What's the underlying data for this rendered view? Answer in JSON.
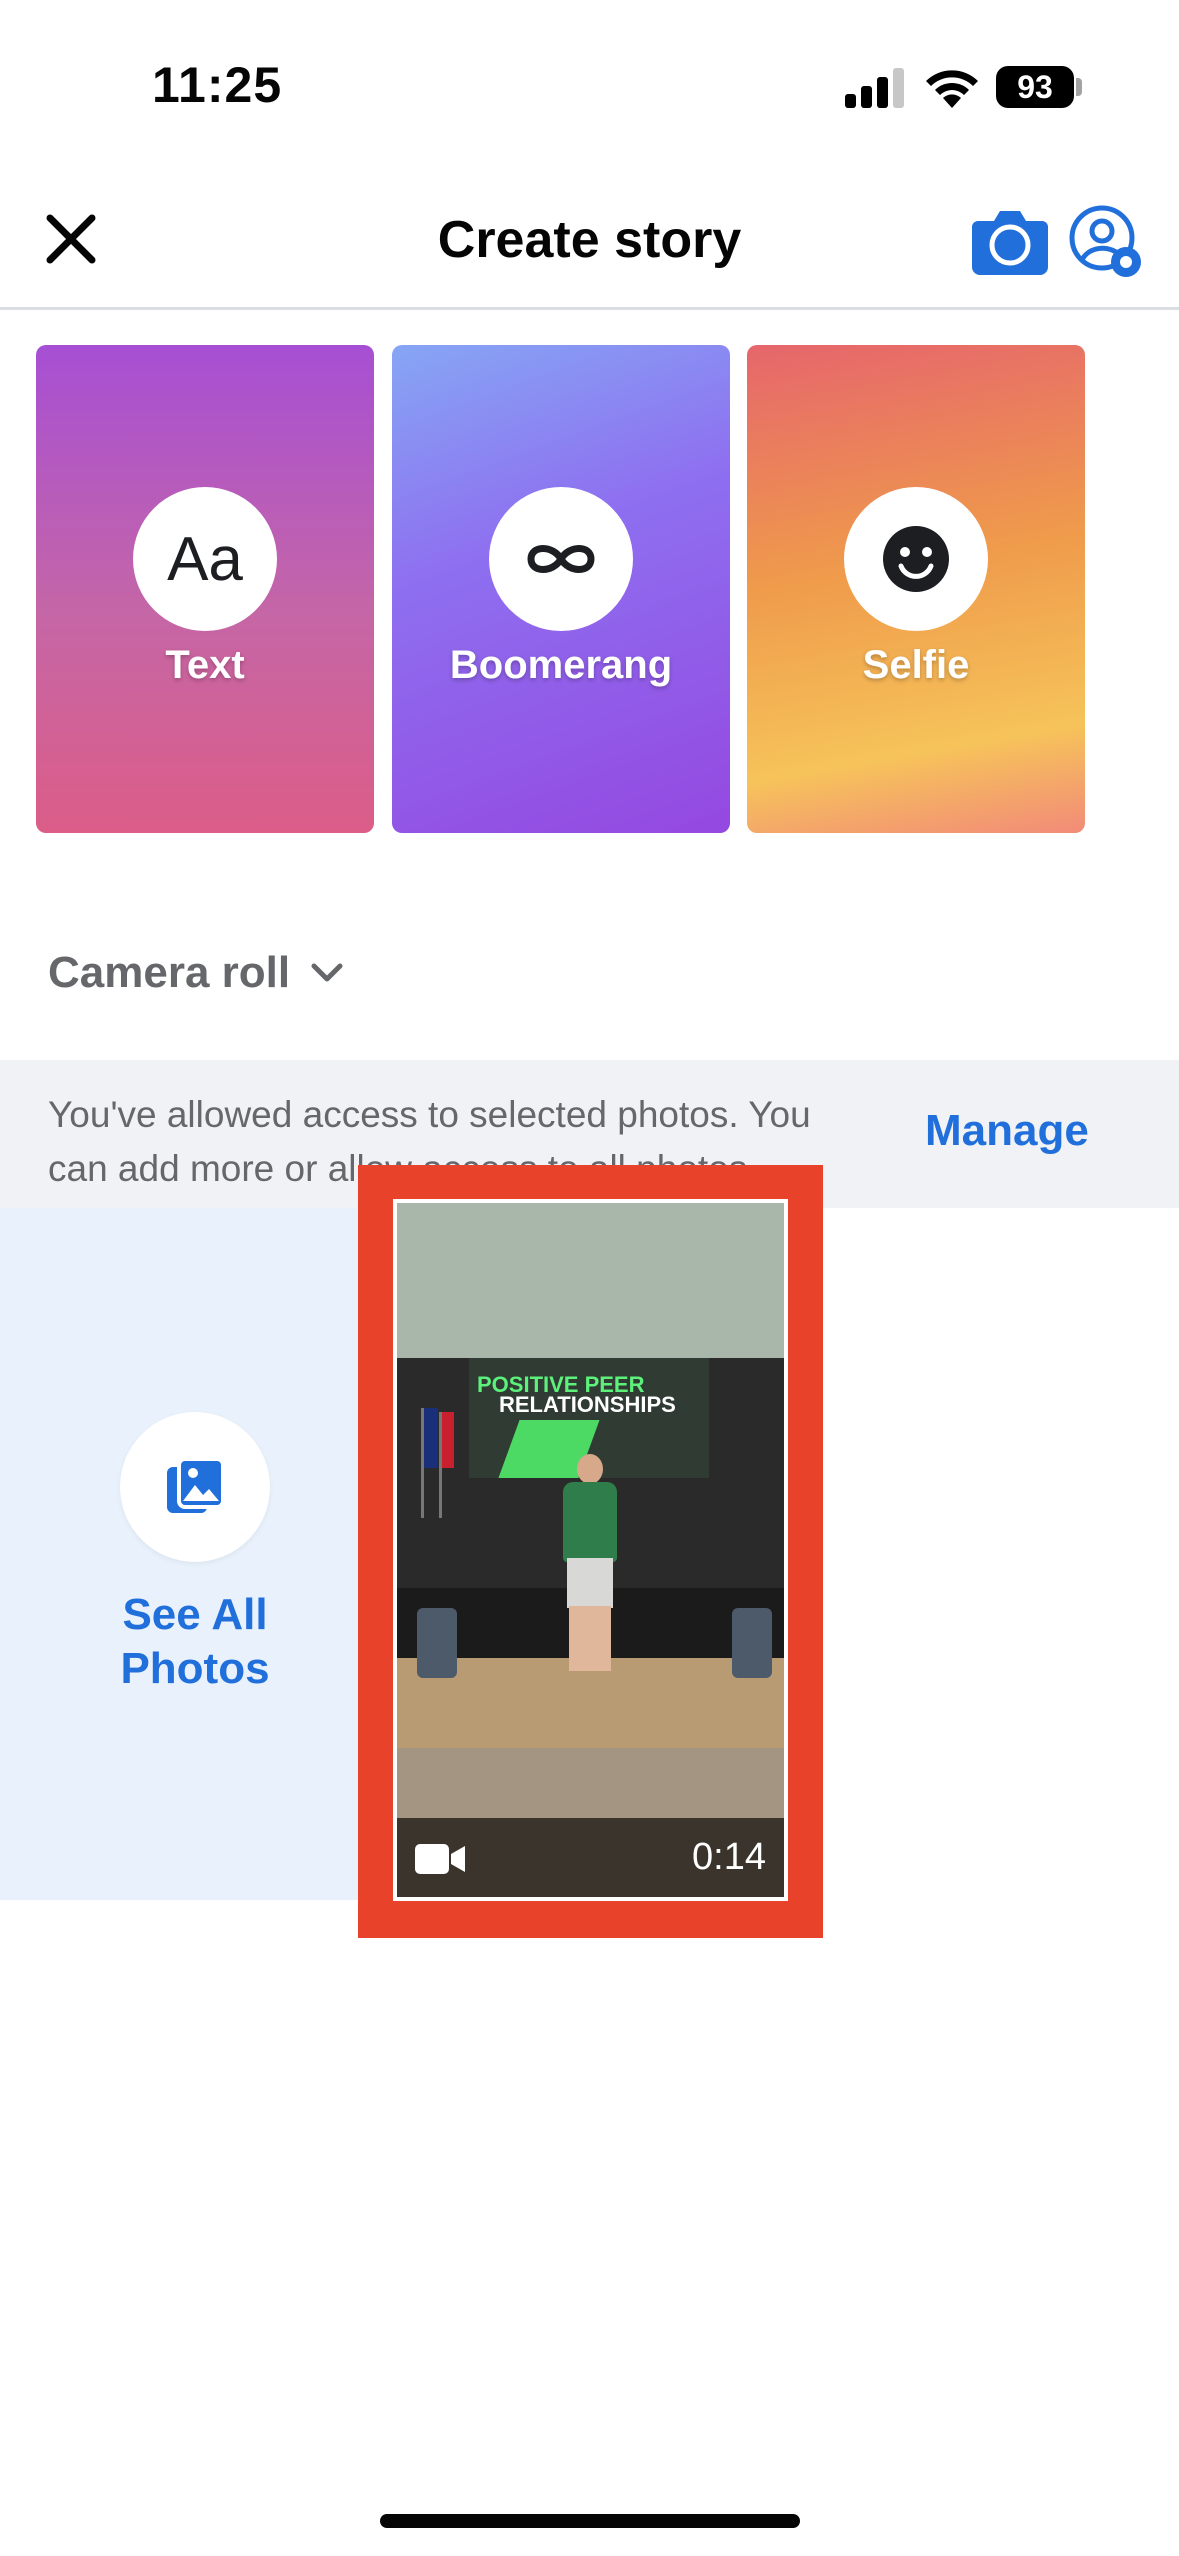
{
  "status_bar": {
    "time": "11:25",
    "battery": "93"
  },
  "header": {
    "title": "Create story"
  },
  "story_options": [
    {
      "label": "Text",
      "glyph": "Aa"
    },
    {
      "label": "Boomerang",
      "glyph": "∞"
    },
    {
      "label": "Selfie"
    }
  ],
  "camera_roll": {
    "label": "Camera roll"
  },
  "access_banner": {
    "message": "You've allowed access to selected photos. You can add more or allow access to all photos.",
    "manage_label": "Manage"
  },
  "gallery": {
    "see_all_label_line1": "See All",
    "see_all_label_line2": "Photos",
    "video": {
      "duration": "0:14",
      "screen_line1": "POSITIVE PEER",
      "screen_line2": "RELATIONSHIPS"
    }
  },
  "colors": {
    "accent": "#216fdb",
    "highlight": "#e8432a",
    "banner_bg": "#f0f2f5",
    "see_all_bg": "#e9f2fc"
  }
}
